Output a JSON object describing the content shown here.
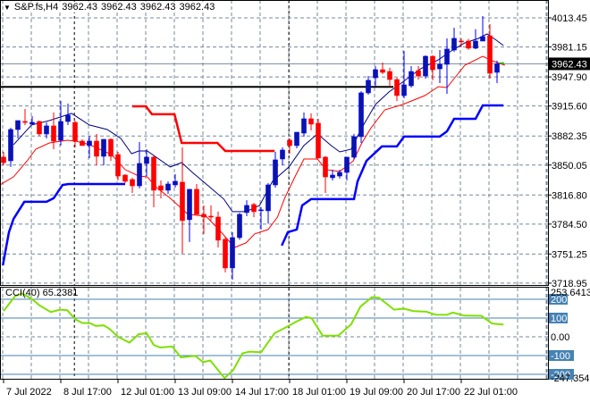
{
  "header": {
    "symbol": "S&P.fs,H4",
    "open": "3962.43",
    "high": "3962.43",
    "low": "3962.43",
    "close": "3962.43",
    "menu_icon": "triangle-down-icon"
  },
  "colors": {
    "bull": "#0A14A8",
    "bear": "#FF0000",
    "mid_line": "#000080",
    "lower_line": "#FF0000",
    "upper_stop": "#FF0000",
    "lower_stop": "#0000FF",
    "cci": "#7FE000",
    "cci_levels": "#4682B4",
    "grid": "#778899"
  },
  "chart_data": [
    {
      "type": "candlestick",
      "title": "S&P.fs,H4",
      "ylim": [
        3716.9,
        4033.3
      ],
      "price_labels": [
        "4013.45",
        "3981.15",
        "3947.90",
        "3915.60",
        "3882.35",
        "3850.05",
        "3816.80",
        "3784.50",
        "3751.25",
        "3718.95"
      ],
      "current_price": "3962.43",
      "x_labels": [
        {
          "bar": 0,
          "text": "7 Jul 2022"
        },
        {
          "bar": 8,
          "text": "8 Jul 17:00"
        },
        {
          "bar": 16,
          "text": "12 Jul 01:00"
        },
        {
          "bar": 24,
          "text": "13 Jul 09:00"
        },
        {
          "bar": 32,
          "text": "14 Jul 17:00"
        },
        {
          "bar": 40,
          "text": "18 Jul 01:00"
        },
        {
          "bar": 48,
          "text": "19 Jul 09:00"
        },
        {
          "bar": 56,
          "text": "20 Jul 17:00"
        },
        {
          "bar": 64,
          "text": "22 Jul 01:00"
        }
      ],
      "day_separators": [
        9.9,
        39.9
      ],
      "support_line": {
        "price": 3936.9,
        "to_bar": 54.5
      },
      "ohlc": [
        [
          3858.8,
          3864.7,
          3849.8,
          3852.8
        ],
        [
          3854.8,
          3891.5,
          3847.9,
          3889.5
        ],
        [
          3889.5,
          3899.4,
          3879.6,
          3899.4
        ],
        [
          3898.4,
          3912.3,
          3894.5,
          3897.4
        ],
        [
          3895.5,
          3904.4,
          3894.5,
          3897.4
        ],
        [
          3898.4,
          3899.4,
          3882.6,
          3884.6
        ],
        [
          3884.6,
          3897.4,
          3879.6,
          3893.5
        ],
        [
          3893.5,
          3908.4,
          3867.7,
          3876.6
        ],
        [
          3877.6,
          3921.2,
          3871.7,
          3898.4
        ],
        [
          3898.4,
          3918.3,
          3894.5,
          3905.4
        ],
        [
          3897.4,
          3899.4,
          3869.7,
          3876.6
        ],
        [
          3876.6,
          3878.6,
          3871.7,
          3871.7
        ],
        [
          3871.7,
          3882.6,
          3857.8,
          3876.6
        ],
        [
          3876.6,
          3884.6,
          3849.8,
          3859.8
        ],
        [
          3859.8,
          3878.6,
          3849.8,
          3878.6
        ],
        [
          3878.6,
          3879.6,
          3854.8,
          3859.8
        ],
        [
          3861.7,
          3864.7,
          3833.0,
          3837.9
        ],
        [
          3838.9,
          3840.0,
          3830.0,
          3832.0
        ],
        [
          3834.0,
          3836.0,
          3819.1,
          3827.0
        ],
        [
          3827.0,
          3875.6,
          3824.1,
          3851.8
        ],
        [
          3851.8,
          3867.7,
          3837.9,
          3858.8
        ],
        [
          3858.8,
          3860.0,
          3803.2,
          3822.1
        ],
        [
          3827.0,
          3833.0,
          3813.0,
          3822.1
        ],
        [
          3822.1,
          3832.0,
          3818.0,
          3829.0
        ],
        [
          3828.0,
          3840.0,
          3825.0,
          3832.0
        ],
        [
          3831.0,
          3869.7,
          3751.7,
          3788.4
        ],
        [
          3789.4,
          3823.1,
          3764.6,
          3823.1
        ],
        [
          3823.1,
          3829.0,
          3795.3,
          3795.3
        ],
        [
          3795.3,
          3805.2,
          3773.5,
          3792.3
        ],
        [
          3793.3,
          3805.2,
          3788.4,
          3792.3
        ],
        [
          3792.3,
          3798.3,
          3758.6,
          3766.6
        ],
        [
          3767.6,
          3770.0,
          3730.9,
          3735.8
        ],
        [
          3735.8,
          3775.5,
          3722.9,
          3769.5
        ],
        [
          3769.5,
          3797.0,
          3767.0,
          3795.3
        ],
        [
          3797.3,
          3811.0,
          3793.3,
          3805.2
        ],
        [
          3806.2,
          3808.0,
          3792.3,
          3798.3
        ],
        [
          3799.3,
          3803.2,
          3778.5,
          3800.3
        ],
        [
          3799.3,
          3830.0,
          3785.0,
          3828.0
        ],
        [
          3828.0,
          3864.7,
          3825.0,
          3855.8
        ],
        [
          3856.8,
          3869.7,
          3849.8,
          3866.7
        ],
        [
          3877.6,
          3879.6,
          3862.7,
          3871.7
        ],
        [
          3871.7,
          3886.5,
          3868.7,
          3886.5
        ],
        [
          3885.5,
          3908.4,
          3881.6,
          3901.4
        ],
        [
          3901.4,
          3907.4,
          3888.5,
          3895.5
        ],
        [
          3896.5,
          3901.4,
          3857.8,
          3857.8
        ],
        [
          3858.8,
          3860.0,
          3819.1,
          3836.9
        ],
        [
          3836.0,
          3845.0,
          3833.0,
          3838.9
        ],
        [
          3837.9,
          3845.0,
          3835.0,
          3841.9
        ],
        [
          3841.9,
          3858.8,
          3833.0,
          3858.8
        ],
        [
          3858.8,
          3884.6,
          3856.8,
          3881.6
        ],
        [
          3881.6,
          3932.0,
          3874.6,
          3930.2
        ],
        [
          3930.2,
          3949.0,
          3928.2,
          3944.1
        ],
        [
          3947.0,
          3959.9,
          3937.1,
          3955.9
        ],
        [
          3955.9,
          3963.9,
          3951.0,
          3953.0
        ],
        [
          3953.9,
          3958.0,
          3937.1,
          3945.0
        ],
        [
          3945.0,
          3947.0,
          3921.2,
          3927.2
        ],
        [
          3927.2,
          3976.8,
          3924.2,
          3939.1
        ],
        [
          3938.1,
          3959.9,
          3936.1,
          3953.9
        ],
        [
          3954.9,
          3960.0,
          3945.0,
          3949.0
        ],
        [
          3949.0,
          3971.8,
          3946.0,
          3970.8
        ],
        [
          3970.8,
          3972.0,
          3944.1,
          3955.9
        ],
        [
          3956.9,
          3977.8,
          3941.1,
          3961.9
        ],
        [
          3961.9,
          3990.7,
          3929.2,
          3978.8
        ],
        [
          3977.8,
          4002.5,
          3975.8,
          3990.7
        ],
        [
          3987.7,
          3990.7,
          3981.0,
          3986.7
        ],
        [
          3987.7,
          3990.0,
          3978.0,
          3979.8
        ],
        [
          3979.8,
          4001.0,
          3978.8,
          3987.7
        ],
        [
          3987.7,
          4015.5,
          3987.7,
          3992.6
        ],
        [
          3993.6,
          4006.5,
          3946.0,
          3952.0
        ],
        [
          3953.0,
          3966.0,
          3941.1,
          3962.43
        ]
      ],
      "series": [
        {
          "name": "mid-line",
          "points": [
            [
              1.4,
              3872.7
            ],
            [
              3.9,
              3894.5
            ],
            [
              6.4,
              3899.4
            ],
            [
              9.5,
              3907.4
            ],
            [
              12,
              3894.5
            ],
            [
              14.5,
              3889.5
            ],
            [
              16.4,
              3879.6
            ],
            [
              17.9,
              3862.7
            ],
            [
              18.9,
              3865.7
            ],
            [
              20.1,
              3865.7
            ],
            [
              23.3,
              3847.9
            ],
            [
              24.9,
              3852.8
            ],
            [
              26.4,
              3841.9
            ],
            [
              28.9,
              3825.1
            ],
            [
              30.8,
              3812.2
            ],
            [
              32,
              3798.3
            ],
            [
              33.9,
              3798.3
            ],
            [
              35.8,
              3805.2
            ],
            [
              37.6,
              3832.0
            ],
            [
              39.9,
              3847.9
            ],
            [
              42,
              3871.7
            ],
            [
              43.9,
              3884.6
            ],
            [
              45.8,
              3871.7
            ],
            [
              47,
              3864.7
            ],
            [
              48.6,
              3867.7
            ],
            [
              50.1,
              3891.5
            ],
            [
              52,
              3917.3
            ],
            [
              53.9,
              3931.2
            ],
            [
              55.8,
              3942.1
            ],
            [
              58.3,
              3956.9
            ],
            [
              60.8,
              3966.9
            ],
            [
              62.6,
              3976.8
            ],
            [
              64.5,
              3985.7
            ],
            [
              66.4,
              3990.7
            ],
            [
              67.6,
              3995.6
            ],
            [
              68.9,
              3988.7
            ],
            [
              69.9,
              3982.7
            ]
          ]
        },
        {
          "name": "lower-line",
          "points": [
            [
              -0.5,
              3828.0
            ],
            [
              1.4,
              3837.0
            ],
            [
              3.3,
              3854.8
            ],
            [
              4.5,
              3867.7
            ],
            [
              6.4,
              3874.6
            ],
            [
              8.9,
              3877.6
            ],
            [
              10.1,
              3876.6
            ],
            [
              12,
              3872.7
            ],
            [
              15.1,
              3861.7
            ],
            [
              17,
              3844.9
            ],
            [
              18.9,
              3837.9
            ],
            [
              20.1,
              3836.9
            ],
            [
              21.4,
              3825.1
            ],
            [
              23.3,
              3813.2
            ],
            [
              25.8,
              3795.3
            ],
            [
              28.3,
              3793.3
            ],
            [
              30.1,
              3778.5
            ],
            [
              32.3,
              3758.6
            ],
            [
              33.9,
              3763.6
            ],
            [
              35.1,
              3773.5
            ],
            [
              37,
              3778.5
            ],
            [
              38.3,
              3792.3
            ],
            [
              39.3,
              3813.2
            ],
            [
              40.8,
              3837.9
            ],
            [
              42,
              3856.8
            ],
            [
              43.9,
              3856.8
            ],
            [
              45.1,
              3844.9
            ],
            [
              47,
              3842.9
            ],
            [
              48.9,
              3854.8
            ],
            [
              50.1,
              3874.6
            ],
            [
              51.4,
              3891.5
            ],
            [
              53.3,
              3911.3
            ],
            [
              55.8,
              3917.3
            ],
            [
              58.9,
              3927.2
            ],
            [
              60.8,
              3937.1
            ],
            [
              62,
              3936.1
            ],
            [
              64.5,
              3960.9
            ],
            [
              67,
              3970.8
            ],
            [
              68.3,
              3965.9
            ],
            [
              70.1,
              3960.9
            ]
          ]
        },
        {
          "name": "upper-stop",
          "segments": [
            [
              [
                18,
                3915.3
              ],
              [
                19.9,
                3915.3
              ],
              [
                20.75,
                3906.4
              ],
              [
                23.9,
                3906.4
              ],
              [
                24.9,
                3874.6
              ],
              [
                29.9,
                3874.6
              ],
              [
                31,
                3865.7
              ],
              [
                37.9,
                3865.7
              ]
            ]
          ]
        },
        {
          "name": "lower-stop",
          "segments": [
            [
              [
                -0.1,
                3738.8
              ],
              [
                0.75,
                3775.5
              ],
              [
                1.4,
                3790.4
              ],
              [
                2.9,
                3809.2
              ],
              [
                6,
                3809.2
              ],
              [
                7,
                3813.2
              ],
              [
                8.25,
                3828.0
              ],
              [
                9.1,
                3829.0
              ],
              [
                17,
                3829.0
              ]
            ],
            [
              [
                38.9,
                3760.6
              ],
              [
                39.75,
                3775.5
              ],
              [
                41,
                3778.5
              ],
              [
                41.75,
                3805.2
              ],
              [
                43,
                3812.2
              ],
              [
                49,
                3812.2
              ],
              [
                49.5,
                3832.0
              ],
              [
                50.75,
                3854.8
              ],
              [
                52.9,
                3870.7
              ],
              [
                55,
                3870.7
              ],
              [
                56,
                3881.6
              ],
              [
                61,
                3881.6
              ],
              [
                62,
                3887.5
              ],
              [
                63,
                3901.4
              ],
              [
                66,
                3901.4
              ],
              [
                67,
                3916.3
              ],
              [
                69.9,
                3916.3
              ]
            ]
          ]
        }
      ]
    },
    {
      "type": "line",
      "title": "CCI(40)",
      "value": "65.2381",
      "ylim": [
        -247.354,
        253.6413
      ],
      "ylim_labels": [
        "253.6413",
        "-247.354"
      ],
      "levels": [
        {
          "value": 200,
          "text": "200"
        },
        {
          "value": 100,
          "text": "100"
        },
        {
          "value": 0,
          "text": "0.00"
        },
        {
          "value": -100,
          "text": "-100"
        },
        {
          "value": -200,
          "text": "-200"
        }
      ],
      "points": [
        [
          0,
          137
        ],
        [
          1.6,
          216
        ],
        [
          2.6,
          231
        ],
        [
          4,
          200
        ],
        [
          5,
          168
        ],
        [
          6.6,
          132
        ],
        [
          7.9,
          145
        ],
        [
          8.9,
          142
        ],
        [
          10,
          94
        ],
        [
          11,
          74
        ],
        [
          12.1,
          72
        ],
        [
          12.9,
          58
        ],
        [
          14,
          61
        ],
        [
          14.8,
          43
        ],
        [
          16,
          0
        ],
        [
          17.6,
          -31
        ],
        [
          18.9,
          14
        ],
        [
          20,
          19
        ],
        [
          21,
          -44
        ],
        [
          21.9,
          -57
        ],
        [
          23.6,
          -52
        ],
        [
          24.8,
          -110
        ],
        [
          26.8,
          -102
        ],
        [
          27.9,
          -135
        ],
        [
          28.9,
          -126
        ],
        [
          30.9,
          -220
        ],
        [
          32.1,
          -178
        ],
        [
          33.4,
          -88
        ],
        [
          34.4,
          -79
        ],
        [
          36,
          -83
        ],
        [
          37.9,
          19
        ],
        [
          40,
          61
        ],
        [
          41,
          82
        ],
        [
          42.3,
          106
        ],
        [
          43.1,
          98
        ],
        [
          44.6,
          6
        ],
        [
          46.8,
          6
        ],
        [
          48.6,
          66
        ],
        [
          49.9,
          161
        ],
        [
          51.5,
          211
        ],
        [
          52.5,
          208
        ],
        [
          54.6,
          145
        ],
        [
          56,
          150
        ],
        [
          57.3,
          137
        ],
        [
          59.1,
          134
        ],
        [
          60.4,
          118
        ],
        [
          62,
          117
        ],
        [
          62.8,
          129
        ],
        [
          64.4,
          113
        ],
        [
          66.8,
          112
        ],
        [
          68.3,
          71
        ],
        [
          69.9,
          65
        ]
      ]
    }
  ]
}
